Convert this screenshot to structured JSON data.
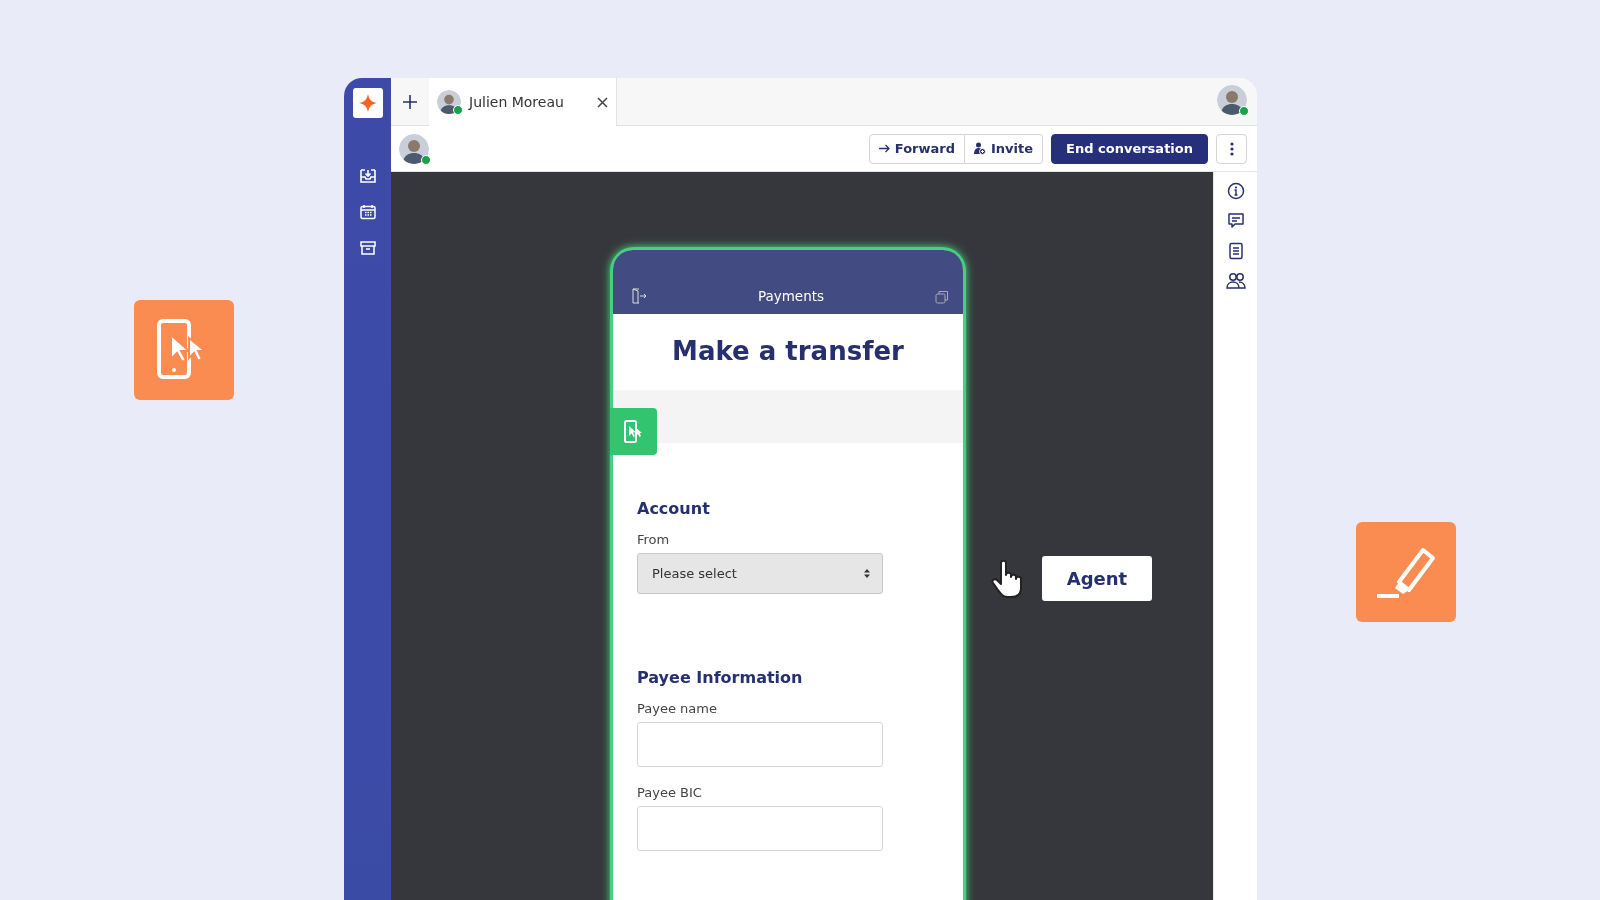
{
  "tabs": [
    {
      "label": "Julien Moreau",
      "selected": true,
      "online": true
    }
  ],
  "user": {
    "online": true
  },
  "contact": {
    "online": true
  },
  "toolbar": {
    "buttons": [
      {
        "label": "Forward",
        "kind": "forward"
      },
      {
        "label": "Invite",
        "kind": "invite"
      },
      {
        "label": "End conversation",
        "kind": "primary"
      }
    ]
  },
  "phone": {
    "header_title": "Payments",
    "heading": "Make a transfer",
    "sections": [
      {
        "title": "Account",
        "fields": [
          {
            "label": "From",
            "kind": "select",
            "value": "Please select"
          }
        ]
      },
      {
        "title": "Payee Information",
        "fields": [
          {
            "label": "Payee name",
            "kind": "input"
          },
          {
            "label": "Payee BIC",
            "kind": "input"
          }
        ]
      }
    ]
  },
  "agent_cursor": {
    "label": "Agent"
  }
}
